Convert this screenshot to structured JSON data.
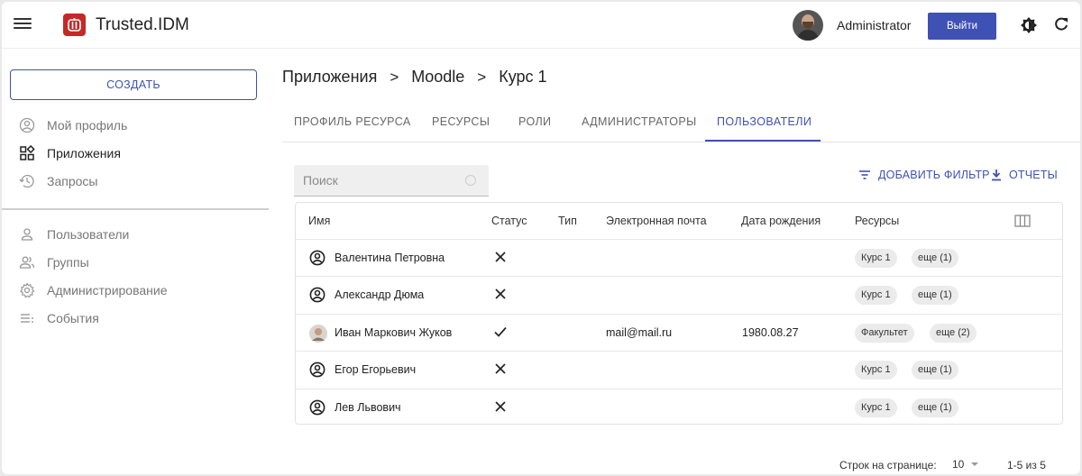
{
  "header": {
    "app_title": "Trusted.IDM",
    "user_name": "Administrator",
    "logout_label": "Выйти"
  },
  "sidebar": {
    "create_label": "СОЗДАТЬ",
    "items": [
      {
        "label": "Мой профиль",
        "icon": "account-circle-icon",
        "active": false
      },
      {
        "label": "Приложения",
        "icon": "apps-icon",
        "active": true
      },
      {
        "label": "Запросы",
        "icon": "history-icon",
        "active": false
      },
      {
        "label": "Пользователи",
        "icon": "person-icon",
        "active": false
      },
      {
        "label": "Группы",
        "icon": "group-icon",
        "active": false
      },
      {
        "label": "Администрирование",
        "icon": "settings-icon",
        "active": false
      },
      {
        "label": "События",
        "icon": "events-list-icon",
        "active": false
      }
    ]
  },
  "breadcrumb": {
    "items": [
      "Приложения",
      "Moodle",
      "Курс 1"
    ],
    "separator": ">"
  },
  "tabs": [
    {
      "label": "ПРОФИЛЬ РЕСУРСА",
      "active": false
    },
    {
      "label": "РЕСУРСЫ",
      "active": false
    },
    {
      "label": "РОЛИ",
      "active": false
    },
    {
      "label": "АДМИНИСТРАТОРЫ",
      "active": false
    },
    {
      "label": "ПОЛЬЗОВАТЕЛИ",
      "active": true
    }
  ],
  "search": {
    "placeholder": "Поиск",
    "value": ""
  },
  "actions": {
    "add_filter": "ДОБАВИТЬ ФИЛЬТР",
    "reports": "ОТЧЕТЫ"
  },
  "table": {
    "columns": [
      "Имя",
      "Статус",
      "Тип",
      "Электронная почта",
      "Дата рождения",
      "Ресурсы"
    ],
    "rows": [
      {
        "name": "Валентина Петровна",
        "status": "inactive",
        "type": "",
        "email": "",
        "birth_date": "",
        "resource": "Курс 1",
        "more": "еще (1)",
        "avatar": false
      },
      {
        "name": "Александр Дюма",
        "status": "inactive",
        "type": "",
        "email": "",
        "birth_date": "",
        "resource": "Курс 1",
        "more": "еще (1)",
        "avatar": false
      },
      {
        "name": "Иван Маркович Жуков",
        "status": "active",
        "type": "",
        "email": "mail@mail.ru",
        "birth_date": "1980.08.27",
        "resource": "Факультет",
        "more": "еще (2)",
        "avatar": true
      },
      {
        "name": "Егор Егорьевич",
        "status": "inactive",
        "type": "",
        "email": "",
        "birth_date": "",
        "resource": "Курс 1",
        "more": "еще (1)",
        "avatar": false
      },
      {
        "name": "Лев Львович",
        "status": "inactive",
        "type": "",
        "email": "",
        "birth_date": "",
        "resource": "Курс 1",
        "more": "еще (1)",
        "avatar": false
      }
    ]
  },
  "pagination": {
    "rows_per_page_label": "Строк на странице:",
    "rows_per_page": "10",
    "range": "1-5 из 5"
  },
  "colors": {
    "accent": "#3f51b5",
    "logo": "#c62828"
  }
}
